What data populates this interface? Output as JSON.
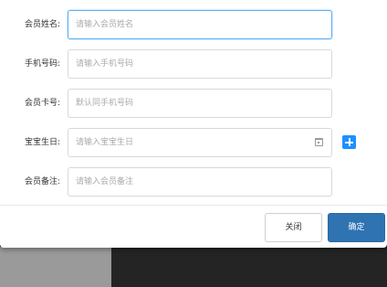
{
  "form": {
    "name": {
      "label": "会员姓名:",
      "placeholder": "请输入会员姓名"
    },
    "phone": {
      "label": "手机号码:",
      "placeholder": "请输入手机号码"
    },
    "card": {
      "label": "会员卡号:",
      "placeholder": "默认同手机号码"
    },
    "baby_birthday": {
      "label": "宝宝生日:",
      "placeholder": "请输入宝宝生日"
    },
    "remark": {
      "label": "会员备注:",
      "placeholder": "请输入会员备注"
    }
  },
  "icons": {
    "calendar": "calendar-icon",
    "add": "plus-icon"
  },
  "footer": {
    "close_label": "关闭",
    "ok_label": "确定"
  },
  "colors": {
    "primary": "#2f73b3",
    "add_button": "#1e90ff",
    "focus_border": "#5aaef0"
  }
}
